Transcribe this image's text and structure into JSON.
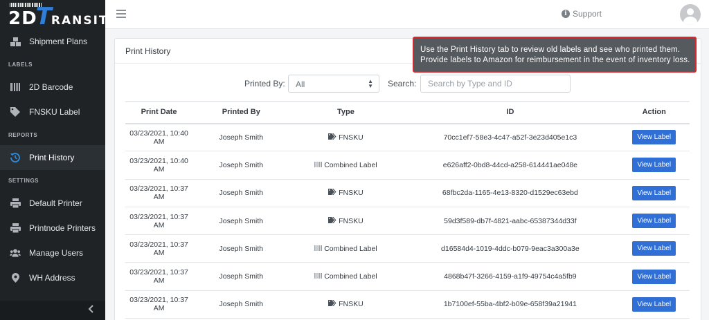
{
  "brand": {
    "logo_prefix": "2D",
    "logo_t": "T",
    "logo_suffix": "RANSIT"
  },
  "sidebar": {
    "top_item": {
      "label": "Shipment Plans",
      "icon": "boxes-icon"
    },
    "sections": [
      {
        "title": "LABELS",
        "items": [
          {
            "label": "2D Barcode",
            "icon": "barcode-icon"
          },
          {
            "label": "FNSKU Label",
            "icon": "tag-icon"
          }
        ]
      },
      {
        "title": "REPORTS",
        "items": [
          {
            "label": "Print History",
            "icon": "history-icon",
            "active": true
          }
        ]
      },
      {
        "title": "SETTINGS",
        "items": [
          {
            "label": "Default Printer",
            "icon": "printer-icon"
          },
          {
            "label": "Printnode Printers",
            "icon": "printer-icon"
          },
          {
            "label": "Manage Users",
            "icon": "users-icon"
          },
          {
            "label": "WH Address",
            "icon": "map-marker-icon"
          }
        ]
      }
    ],
    "collapse_icon": "chevron-left-icon"
  },
  "topbar": {
    "support_label": "Support"
  },
  "card": {
    "title": "Print History"
  },
  "filters": {
    "printed_by_label": "Printed By:",
    "printed_by_value": "All",
    "search_label": "Search:",
    "search_placeholder": "Search by Type and ID"
  },
  "table": {
    "columns": [
      "Print Date",
      "Printed By",
      "Type",
      "ID",
      "Action"
    ],
    "action_label": "View Label",
    "rows": [
      {
        "date": "03/23/2021, 10:40 AM",
        "by": "Joseph Smith",
        "type": "FNSKU",
        "type_icon": "tags-icon",
        "id": "70cc1ef7-58e3-4c47-a52f-3e23d405e1c3"
      },
      {
        "date": "03/23/2021, 10:40 AM",
        "by": "Joseph Smith",
        "type": "Combined Label",
        "type_icon": "barcode-icon",
        "id": "e626aff2-0bd8-44cd-a258-614441ae048e"
      },
      {
        "date": "03/23/2021, 10:37 AM",
        "by": "Joseph Smith",
        "type": "FNSKU",
        "type_icon": "tags-icon",
        "id": "68fbc2da-1165-4e13-8320-d1529ec63ebd"
      },
      {
        "date": "03/23/2021, 10:37 AM",
        "by": "Joseph Smith",
        "type": "FNSKU",
        "type_icon": "tags-icon",
        "id": "59d3f589-db7f-4821-aabc-65387344d33f"
      },
      {
        "date": "03/23/2021, 10:37 AM",
        "by": "Joseph Smith",
        "type": "Combined Label",
        "type_icon": "barcode-icon",
        "id": "d16584d4-1019-4ddc-b079-9eac3a300a3e"
      },
      {
        "date": "03/23/2021, 10:37 AM",
        "by": "Joseph Smith",
        "type": "Combined Label",
        "type_icon": "barcode-icon",
        "id": "4868b47f-3266-4159-a1f9-49754c4a5fb9"
      },
      {
        "date": "03/23/2021, 10:37 AM",
        "by": "Joseph Smith",
        "type": "FNSKU",
        "type_icon": "tags-icon",
        "id": "1b7100ef-55ba-4bf2-b09e-658f39a21941"
      }
    ]
  },
  "tooltip": {
    "line1": "Use the Print History tab to review old labels and see who printed them.",
    "line2": "Provide labels to Amazon for reimbursement in the event of inventory loss."
  },
  "colors": {
    "sidebar_bg": "#1f2326",
    "accent": "#2f6fd6",
    "tooltip_border": "#d9272e"
  }
}
